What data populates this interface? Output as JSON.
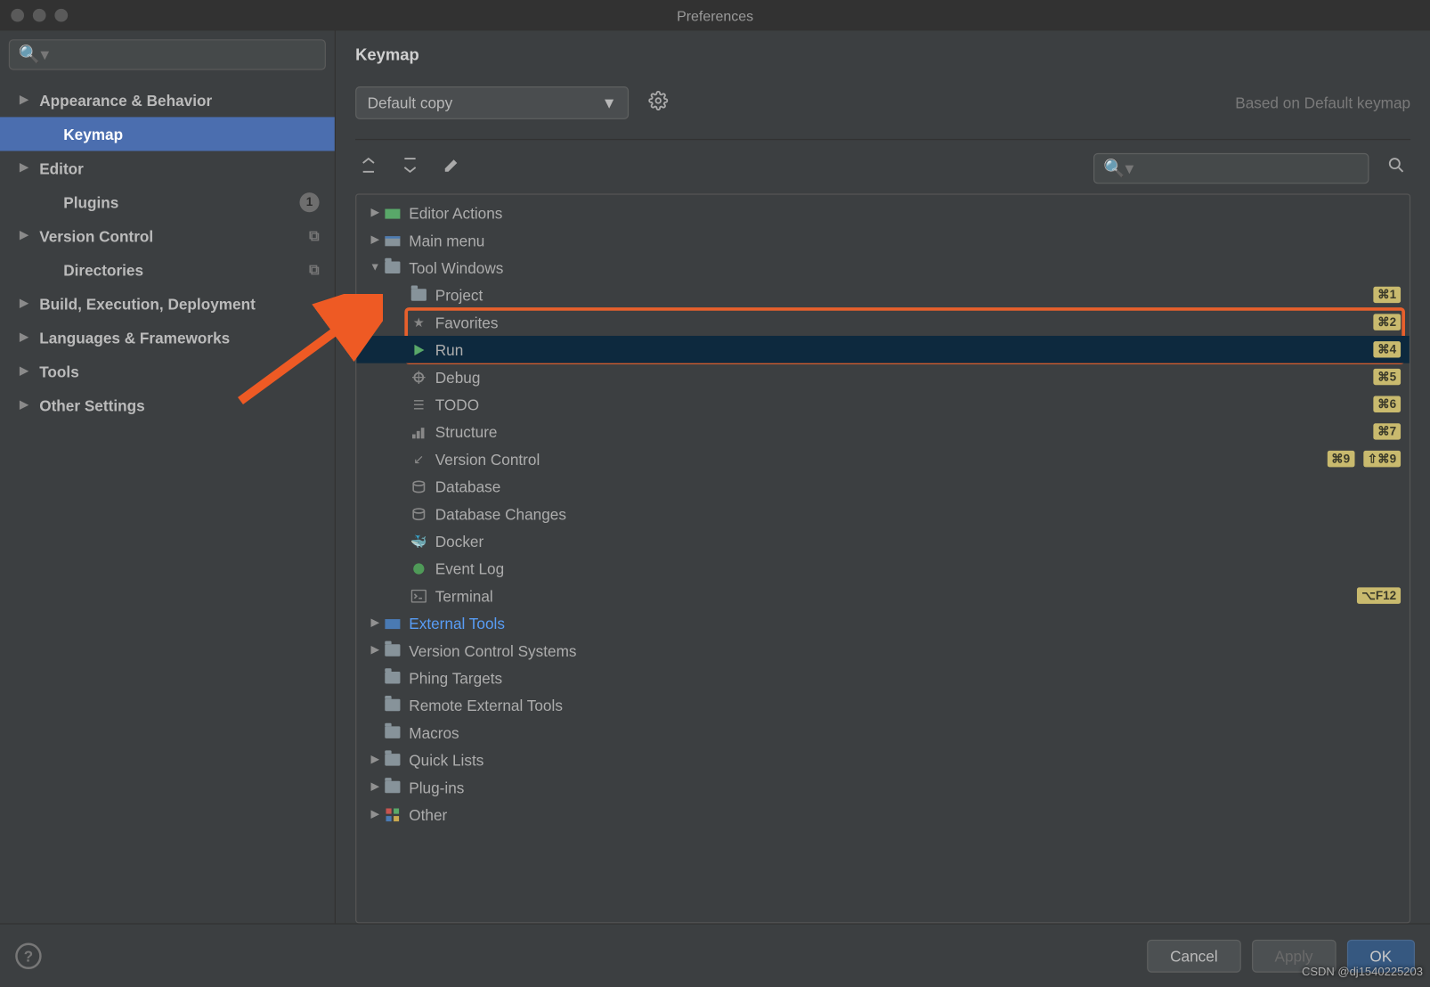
{
  "title": "Preferences",
  "sidebar": {
    "search_placeholder": "Q▾",
    "items": [
      {
        "label": "Appearance & Behavior",
        "expandable": true,
        "child": false
      },
      {
        "label": "Keymap",
        "expandable": false,
        "child": true,
        "selected": true
      },
      {
        "label": "Editor",
        "expandable": true,
        "child": false
      },
      {
        "label": "Plugins",
        "expandable": false,
        "child": true,
        "badge": "1"
      },
      {
        "label": "Version Control",
        "expandable": true,
        "child": false,
        "copy": true
      },
      {
        "label": "Directories",
        "expandable": false,
        "child": true,
        "copy": true
      },
      {
        "label": "Build, Execution, Deployment",
        "expandable": true,
        "child": false
      },
      {
        "label": "Languages & Frameworks",
        "expandable": true,
        "child": false
      },
      {
        "label": "Tools",
        "expandable": true,
        "child": false
      },
      {
        "label": "Other Settings",
        "expandable": true,
        "child": false
      }
    ]
  },
  "main": {
    "title": "Keymap",
    "scheme": "Default copy",
    "based_label": "Based on Default keymap",
    "search_placeholder": "Q▾",
    "tree": [
      {
        "depth": 0,
        "arrow": "▶",
        "icon": "editor-actions-icon",
        "label": "Editor Actions"
      },
      {
        "depth": 0,
        "arrow": "▶",
        "icon": "main-menu-icon",
        "label": "Main menu"
      },
      {
        "depth": 0,
        "arrow": "▼",
        "icon": "folder-icon",
        "label": "Tool Windows",
        "open": true
      },
      {
        "depth": 1,
        "icon": "folder-icon",
        "label": "Project",
        "shortcuts": [
          "⌘1"
        ]
      },
      {
        "depth": 1,
        "icon": "star-icon",
        "label": "Favorites",
        "shortcuts": [
          "⌘2"
        ]
      },
      {
        "depth": 1,
        "icon": "run-icon",
        "label": "Run",
        "shortcuts": [
          "⌘4"
        ],
        "selected": true
      },
      {
        "depth": 1,
        "icon": "debug-icon",
        "label": "Debug",
        "shortcuts": [
          "⌘5"
        ]
      },
      {
        "depth": 1,
        "icon": "todo-icon",
        "label": "TODO",
        "shortcuts": [
          "⌘6"
        ]
      },
      {
        "depth": 1,
        "icon": "structure-icon",
        "label": "Structure",
        "shortcuts": [
          "⌘7"
        ]
      },
      {
        "depth": 1,
        "icon": "vcs-icon",
        "label": "Version Control",
        "shortcuts": [
          "⌘9",
          "⇧⌘9"
        ]
      },
      {
        "depth": 1,
        "icon": "database-icon",
        "label": "Database"
      },
      {
        "depth": 1,
        "icon": "dbchanges-icon",
        "label": "Database Changes"
      },
      {
        "depth": 1,
        "icon": "docker-icon",
        "label": "Docker"
      },
      {
        "depth": 1,
        "icon": "eventlog-icon",
        "label": "Event Log"
      },
      {
        "depth": 1,
        "icon": "terminal-icon",
        "label": "Terminal",
        "shortcuts": [
          "⌥F12"
        ]
      },
      {
        "depth": 0,
        "arrow": "▶",
        "icon": "extern-icon",
        "label": "External Tools",
        "link": true
      },
      {
        "depth": 0,
        "arrow": "▶",
        "icon": "folder-icon",
        "label": "Version Control Systems"
      },
      {
        "depth": 0,
        "icon": "phing-icon",
        "label": "Phing Targets",
        "leaf0": true
      },
      {
        "depth": 0,
        "icon": "folder-icon",
        "label": "Remote External Tools",
        "leaf0": true
      },
      {
        "depth": 0,
        "icon": "folder-icon",
        "label": "Macros",
        "leaf0": true
      },
      {
        "depth": 0,
        "arrow": "▶",
        "icon": "folder-icon",
        "label": "Quick Lists"
      },
      {
        "depth": 0,
        "arrow": "▶",
        "icon": "folder-icon",
        "label": "Plug-ins"
      },
      {
        "depth": 0,
        "arrow": "▶",
        "icon": "other-icon",
        "label": "Other"
      }
    ]
  },
  "footer": {
    "cancel": "Cancel",
    "apply": "Apply",
    "ok": "OK"
  },
  "watermark": "CSDN @dj1540225203"
}
